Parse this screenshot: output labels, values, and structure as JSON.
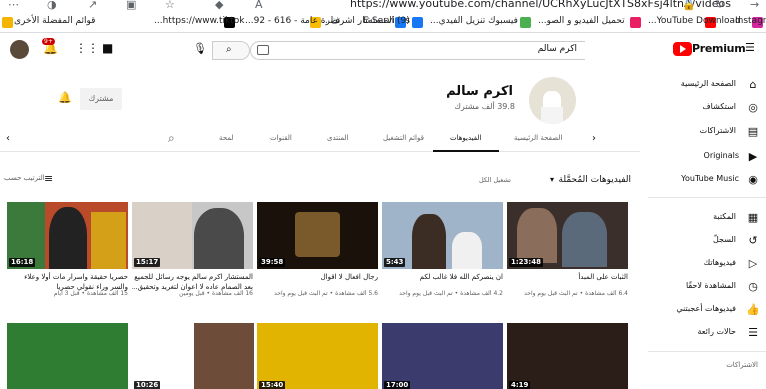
{
  "browser": {
    "url": "https://www.youtube.com/channel/UCRhXyLucJtXTS8xFsj4ltnA/videos",
    "bookmarks": [
      {
        "label": "Instagram",
        "color": "#d6249f"
      },
      {
        "label": "YouTube Download...",
        "color": "#ff0000"
      },
      {
        "label": "تحميل الفيديو و الصو...",
        "color": "#e91e63"
      },
      {
        "label": "فيسبوك تنزيل الفيدي...",
        "color": "#4caf50"
      },
      {
        "label": "E-Services",
        "color": "#1877f2"
      },
      {
        "label": "(9) المستشار اشرف...",
        "color": "#1877f2"
      },
      {
        "label": "نظرة عامة - 616 - 92...",
        "color": "#fbbc04"
      },
      {
        "label": "https://www.tiktok...",
        "color": "#000000"
      },
      {
        "label": "قوائم المفضلة الأخرى",
        "color": "#f4b400"
      }
    ]
  },
  "header": {
    "logo": "Premium",
    "search_value": "اكرم سالم",
    "notifications_badge": "9+"
  },
  "sidebar": {
    "items": [
      {
        "label": "الصفحة الرئيسية",
        "icon": "home-icon",
        "glyph": "⌂"
      },
      {
        "label": "استكشاف",
        "icon": "explore-icon",
        "glyph": "◎"
      },
      {
        "label": "الاشتراكات",
        "icon": "subscriptions-icon",
        "glyph": "▤"
      },
      {
        "label": "Originals",
        "icon": "originals-icon",
        "glyph": "▶"
      },
      {
        "label": "YouTube Music",
        "icon": "music-icon",
        "glyph": "◉"
      },
      {
        "label": "المكتبة",
        "icon": "library-icon",
        "glyph": "▦"
      },
      {
        "label": "السجلّ",
        "icon": "history-icon",
        "glyph": "↺"
      },
      {
        "label": "فيديوهاتك",
        "icon": "your-videos-icon",
        "glyph": "▷"
      },
      {
        "label": "المشاهدة لاحقًا",
        "icon": "watch-later-icon",
        "glyph": "◷"
      },
      {
        "label": "فيديوهات أعجبتني",
        "icon": "liked-icon",
        "glyph": "👍"
      },
      {
        "label": "حالات رائعة",
        "icon": "playlist-icon",
        "glyph": "☰"
      }
    ],
    "section_title": "الاشتراكات"
  },
  "channel": {
    "name": "اكرم سالم",
    "subscribers": "39.8 ألف مشترك",
    "subscribed_label": "مشترك"
  },
  "tabs": [
    "الصفحة الرئيسية",
    "الفيديوهات",
    "قوائم التشغيل",
    "المنتدى",
    "القنوات",
    "لمحة"
  ],
  "section": {
    "title": "الفيديوهات المُحمَّلة",
    "play_all": "تشغيل الكل",
    "sort": "الترتيب حسب"
  },
  "videos": [
    {
      "title": "الثبات على المبدأ",
      "meta": "6.4 ألف مشاهدة • تم البث قبل يوم واحد",
      "duration": "1:23:48",
      "bg": "#3a2f2a"
    },
    {
      "title": "ان ينصركم الله فلا غالب لكم",
      "meta": "4.2 ألف مشاهدة • تم البث قبل يوم واحد",
      "duration": "5:43",
      "bg": "#9fb4c8"
    },
    {
      "title": "رجال افعال لا اقوال",
      "meta": "5.6 ألف مشاهدة • تم البث قبل يوم واحد",
      "duration": "39:58",
      "bg": "#1a120a"
    },
    {
      "title": "المستشار اكرم سالم يوجه رسائل للجميع",
      "title2": "بعد الصمام عاده لا اعوان لتغريد وتحقيق...",
      "meta": "16 ألف مشاهدة • قبل يومين",
      "duration": "15:17",
      "bg": "#c7c7c7"
    },
    {
      "title": "حصريا حقيقة واسرار مات أولا وعلاء",
      "title2": "والسر وراء نقولي حصريا",
      "meta": "15 ألف مشاهدة • قبل 3 أيام",
      "duration": "16:18",
      "bg": "#b94a2a"
    }
  ],
  "videos_row2": [
    {
      "duration": "4:19",
      "bg": "#2b1d17"
    },
    {
      "duration": "17:00",
      "bg": "#3b3b6e"
    },
    {
      "duration": "15:40",
      "bg": "#e0b400"
    },
    {
      "duration": "",
      "bg": "#6d4c3a"
    },
    {
      "duration": "10:26",
      "bg": "#ffffff"
    },
    {
      "duration": "",
      "bg": "#2e7d32"
    }
  ]
}
